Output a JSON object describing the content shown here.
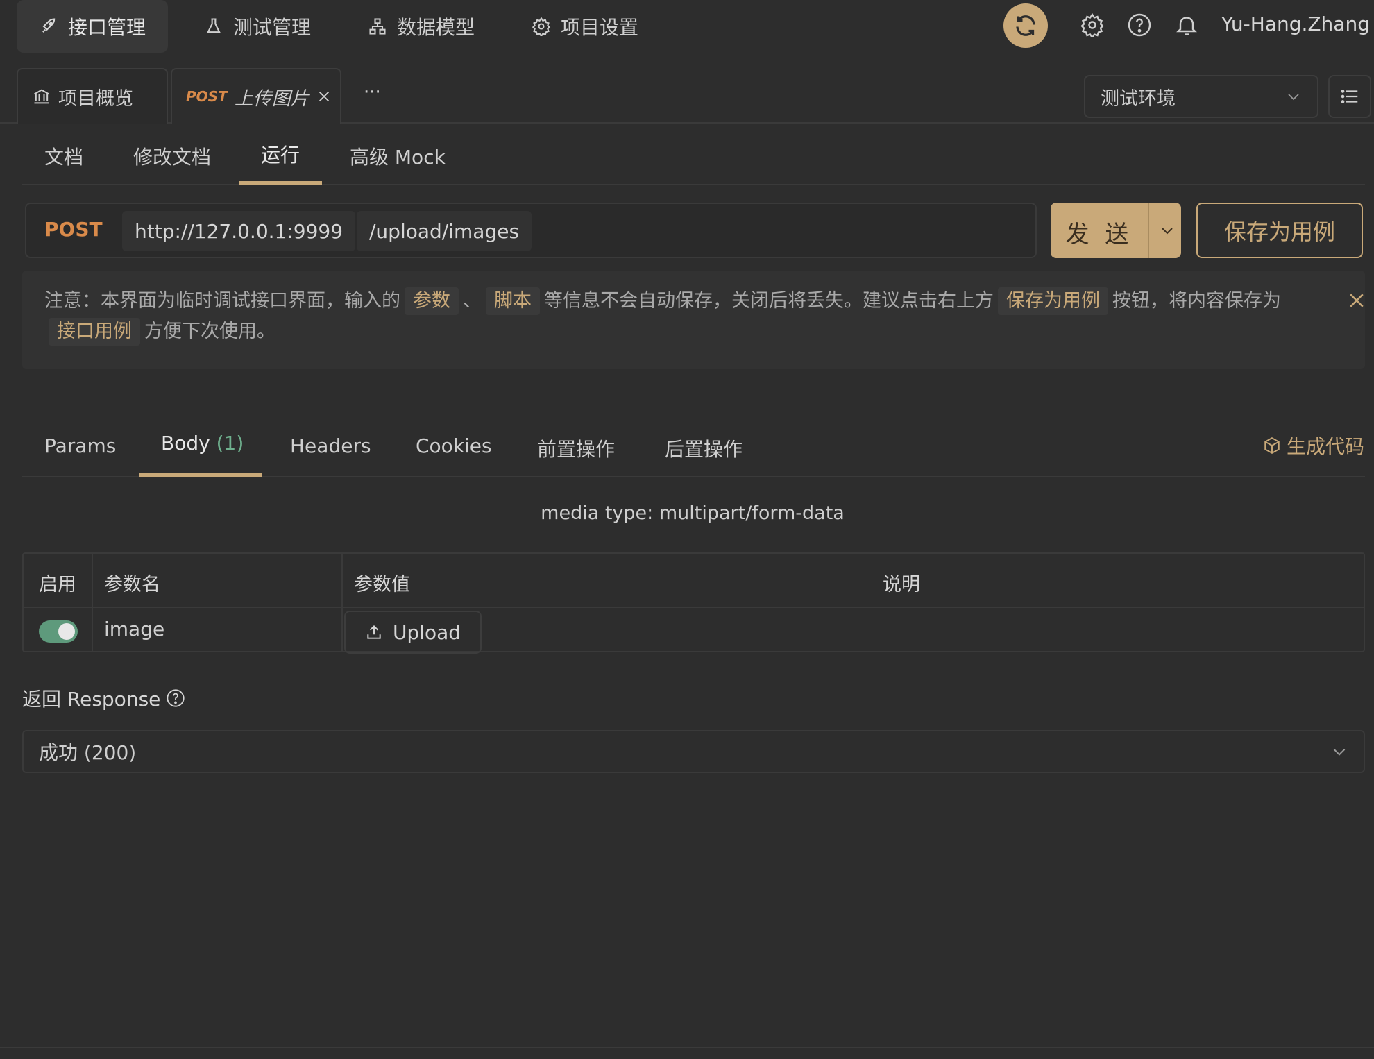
{
  "nav": {
    "items": [
      {
        "label": "接口管理",
        "icon": "rocket-icon",
        "active": true
      },
      {
        "label": "测试管理",
        "icon": "flask-icon",
        "active": false
      },
      {
        "label": "数据模型",
        "icon": "hierarchy-icon",
        "active": false
      },
      {
        "label": "项目设置",
        "icon": "gear-icon",
        "active": false
      }
    ],
    "username": "Yu-Hang.Zhang"
  },
  "tabs": {
    "overview_label": "项目概览",
    "active_tab_method": "POST",
    "active_tab_label": "上传图片",
    "more": "···",
    "environment": "测试环境"
  },
  "subtabs": {
    "doc": "文档",
    "edit": "修改文档",
    "run": "运行",
    "mock": "高级 Mock",
    "active": "运行"
  },
  "request": {
    "method": "POST",
    "base_url": "http://127.0.0.1:9999",
    "path": "/upload/images",
    "send_label": "发 送",
    "save_case_label": "保存为用例"
  },
  "notice": {
    "part1": "注意：本界面为临时调试接口界面，输入的",
    "chip1": "参数",
    "sep": "、",
    "chip2": "脚本",
    "part2": "等信息不会自动保存，关闭后将丢失。建议点击右上方",
    "chip3": "保存为用例",
    "part3": "按钮，将内容保存为",
    "chip4": "接口用例",
    "part4": "方便下次使用。"
  },
  "body_tabs": {
    "params": "Params",
    "body": "Body",
    "body_count": "(1)",
    "headers": "Headers",
    "cookies": "Cookies",
    "pre": "前置操作",
    "post": "后置操作",
    "generate_code": "生成代码"
  },
  "media_type": "media type: multipart/form-data",
  "param_table": {
    "headers": {
      "enabled": "启用",
      "name": "参数名",
      "value": "参数值",
      "desc": "说明"
    },
    "rows": [
      {
        "enabled": true,
        "name": "image",
        "value_button": "Upload",
        "desc": ""
      }
    ]
  },
  "response": {
    "label": "返回 Response",
    "selected": "成功 (200)"
  },
  "colors": {
    "accent": "#c9a979",
    "method_post": "#d98a4a",
    "toggle_on": "#5e9a7c",
    "count_green": "#6fb08e"
  }
}
